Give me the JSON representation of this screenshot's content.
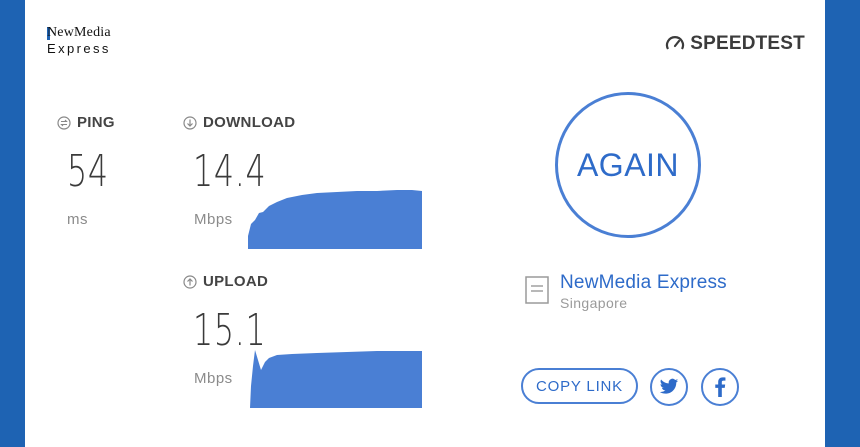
{
  "brand": {
    "logo_line1": "NewMedia",
    "logo_line2": "Express",
    "speedtest_label": "SPEEDTEST"
  },
  "ping": {
    "label": "PING",
    "value": "54",
    "unit": "ms"
  },
  "download": {
    "label": "DOWNLOAD",
    "value": "14.4",
    "unit": "Mbps"
  },
  "upload": {
    "label": "UPLOAD",
    "value": "15.1",
    "unit": "Mbps"
  },
  "again_label": "AGAIN",
  "server": {
    "name": "NewMedia Express",
    "location": "Singapore"
  },
  "actions": {
    "copy_link_label": "COPY LINK"
  },
  "icons": {
    "ping": "ping-icon",
    "download": "download-arrow-icon",
    "upload": "upload-arrow-icon",
    "gauge": "speedometer-icon",
    "server": "server-document-icon",
    "twitter": "twitter-icon",
    "facebook": "facebook-icon"
  },
  "colors": {
    "accent": "#4a7fd4",
    "graph_fill": "#4a7fd4",
    "frame": "#1e63b3"
  }
}
